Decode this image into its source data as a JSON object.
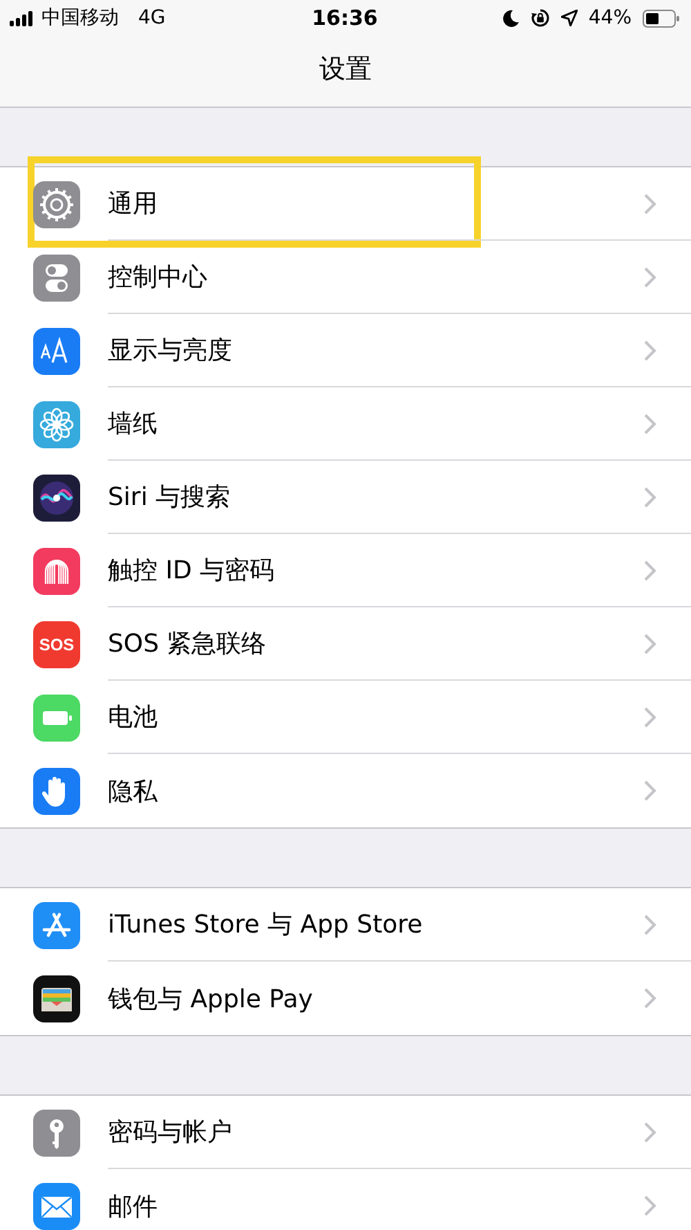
{
  "status_bar": {
    "carrier": "中国移动",
    "network": "4G",
    "time": "16:36",
    "battery": "44%"
  },
  "nav_bar": {
    "title": "设置"
  },
  "groups": [
    {
      "rows": [
        {
          "label": "通用",
          "highlighted": true
        },
        {
          "label": "控制中心",
          "highlighted": false
        },
        {
          "label": "显示与亮度",
          "highlighted": false
        },
        {
          "label": "墙纸",
          "highlighted": false
        },
        {
          "label": "Siri 与搜索",
          "highlighted": false
        },
        {
          "label": "触控 ID 与密码",
          "highlighted": false
        },
        {
          "label": "SOS 紧急联络",
          "highlighted": false,
          "icon_text": "SOS"
        },
        {
          "label": "电池",
          "highlighted": false
        },
        {
          "label": "隐私",
          "highlighted": false
        }
      ]
    },
    {
      "rows": [
        {
          "label": "iTunes Store 与 App Store",
          "highlighted": false
        },
        {
          "label": "钱包与 Apple Pay",
          "highlighted": false
        }
      ]
    },
    {
      "rows": [
        {
          "label": "密码与帐户",
          "highlighted": false
        },
        {
          "label": "邮件",
          "highlighted": false
        }
      ]
    }
  ]
}
